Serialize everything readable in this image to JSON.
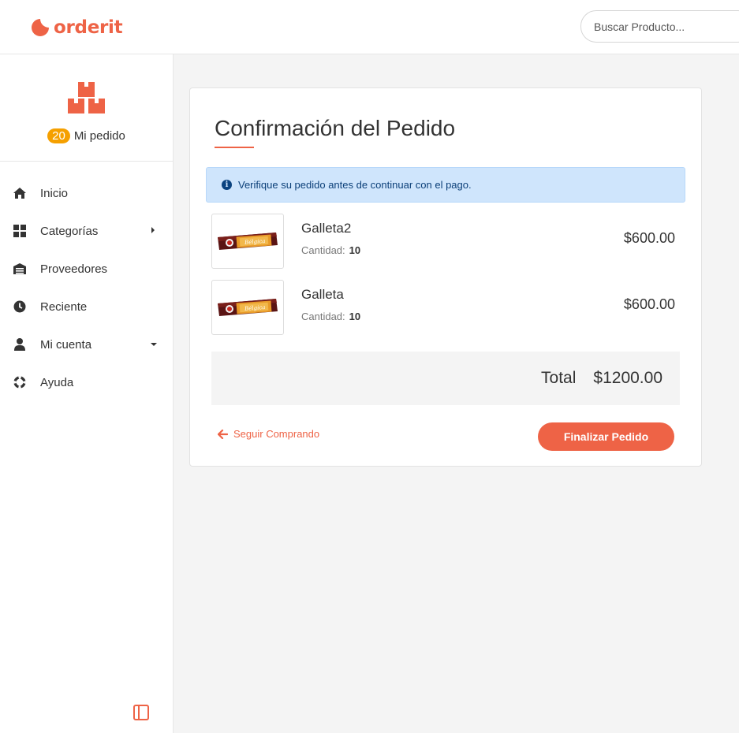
{
  "header": {
    "brand": "orderit",
    "search_placeholder": "Buscar Producto..."
  },
  "sidebar": {
    "order_count": "20",
    "order_label": "Mi pedido",
    "items": [
      {
        "label": "Inicio",
        "icon": "home-icon"
      },
      {
        "label": "Categorías",
        "icon": "grid-icon",
        "caret": "right"
      },
      {
        "label": "Proveedores",
        "icon": "warehouse-icon"
      },
      {
        "label": "Reciente",
        "icon": "clock-icon"
      },
      {
        "label": "Mi cuenta",
        "icon": "user-icon",
        "caret": "down"
      },
      {
        "label": "Ayuda",
        "icon": "lifebuoy-icon"
      }
    ]
  },
  "order": {
    "title": "Confirmación del Pedido",
    "alert": "Verifique su pedido antes de continuar con el pago.",
    "qty_label": "Cantidad:",
    "items": [
      {
        "name": "Galleta2",
        "quantity": "10",
        "price": "$600.00",
        "product_text": "Bélgica"
      },
      {
        "name": "Galleta",
        "quantity": "10",
        "price": "$600.00",
        "product_text": "Bélgica"
      }
    ],
    "total_label": "Total",
    "total_value": "$1200.00",
    "back_label": "Seguir Comprando",
    "finish_label": "Finalizar Pedido"
  },
  "colors": {
    "accent": "#ee6346",
    "badge": "#f5a000",
    "alert_bg": "#cfe5fc",
    "alert_text": "#0b3f78"
  }
}
